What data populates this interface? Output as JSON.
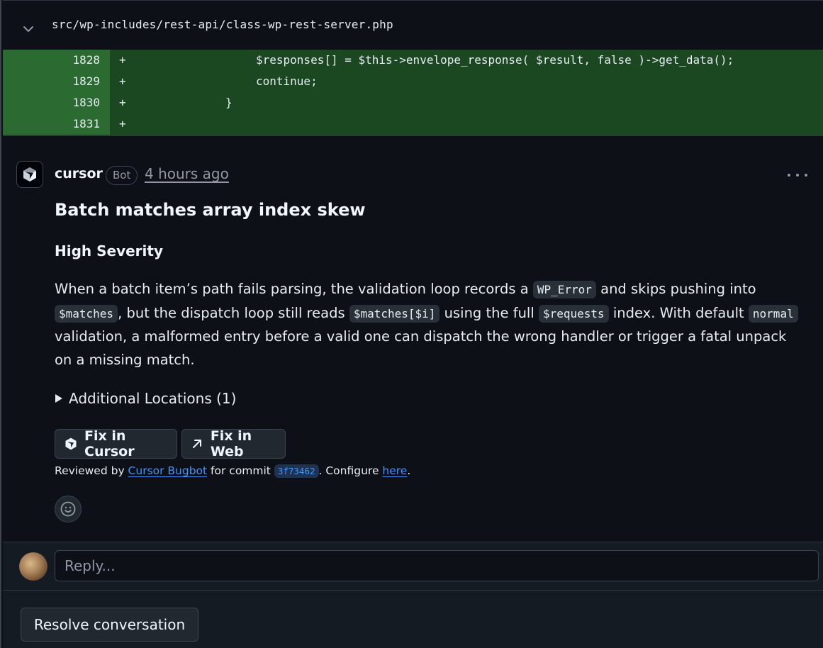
{
  "file": {
    "path": "src/wp-includes/rest-api/class-wp-rest-server.php"
  },
  "diff": {
    "lines": [
      {
        "number": "1828",
        "sign": "+",
        "code": "$responses[] = $this->envelope_response( $result, false )->get_data();"
      },
      {
        "number": "1829",
        "sign": "+",
        "code": "continue;"
      },
      {
        "number": "1830",
        "sign": "+",
        "code": "}"
      },
      {
        "number": "1831",
        "sign": "+",
        "code": ""
      }
    ]
  },
  "comment": {
    "author": "cursor",
    "badge": "Bot",
    "time": "4 hours ago",
    "title": "Batch matches array index skew",
    "severity": "High Severity",
    "body": {
      "t1": "When a batch item’s path fails parsing, the validation loop records a ",
      "c1": "WP_Error",
      "t2": " and skips pushing into ",
      "c2": "$matches",
      "t3": ", but the dispatch loop still reads ",
      "c3": "$matches[$i]",
      "t4": " using the full ",
      "c4": "$requests",
      "t5": " index. With default ",
      "c5": "normal",
      "t6": " validation, a malformed entry before a valid one can dispatch the wrong handler or trigger a fatal unpack on a missing match."
    },
    "additional_locations": "Additional Locations (1)",
    "buttons": {
      "fix_cursor": "Fix in Cursor",
      "fix_web": "Fix in Web"
    },
    "reviewed": {
      "prefix": "Reviewed by ",
      "link": "Cursor Bugbot",
      "mid": " for commit ",
      "sha": "3f73462",
      "after": ". Configure ",
      "configure_link": "here",
      "end": "."
    }
  },
  "reply": {
    "placeholder": "Reply..."
  },
  "resolve": {
    "label": "Resolve conversation"
  },
  "colors": {
    "added_line_bg": "#1b4721",
    "added_number_bg": "#2b6a30",
    "link": "#4493f8",
    "page_bg": "#0d1117"
  }
}
